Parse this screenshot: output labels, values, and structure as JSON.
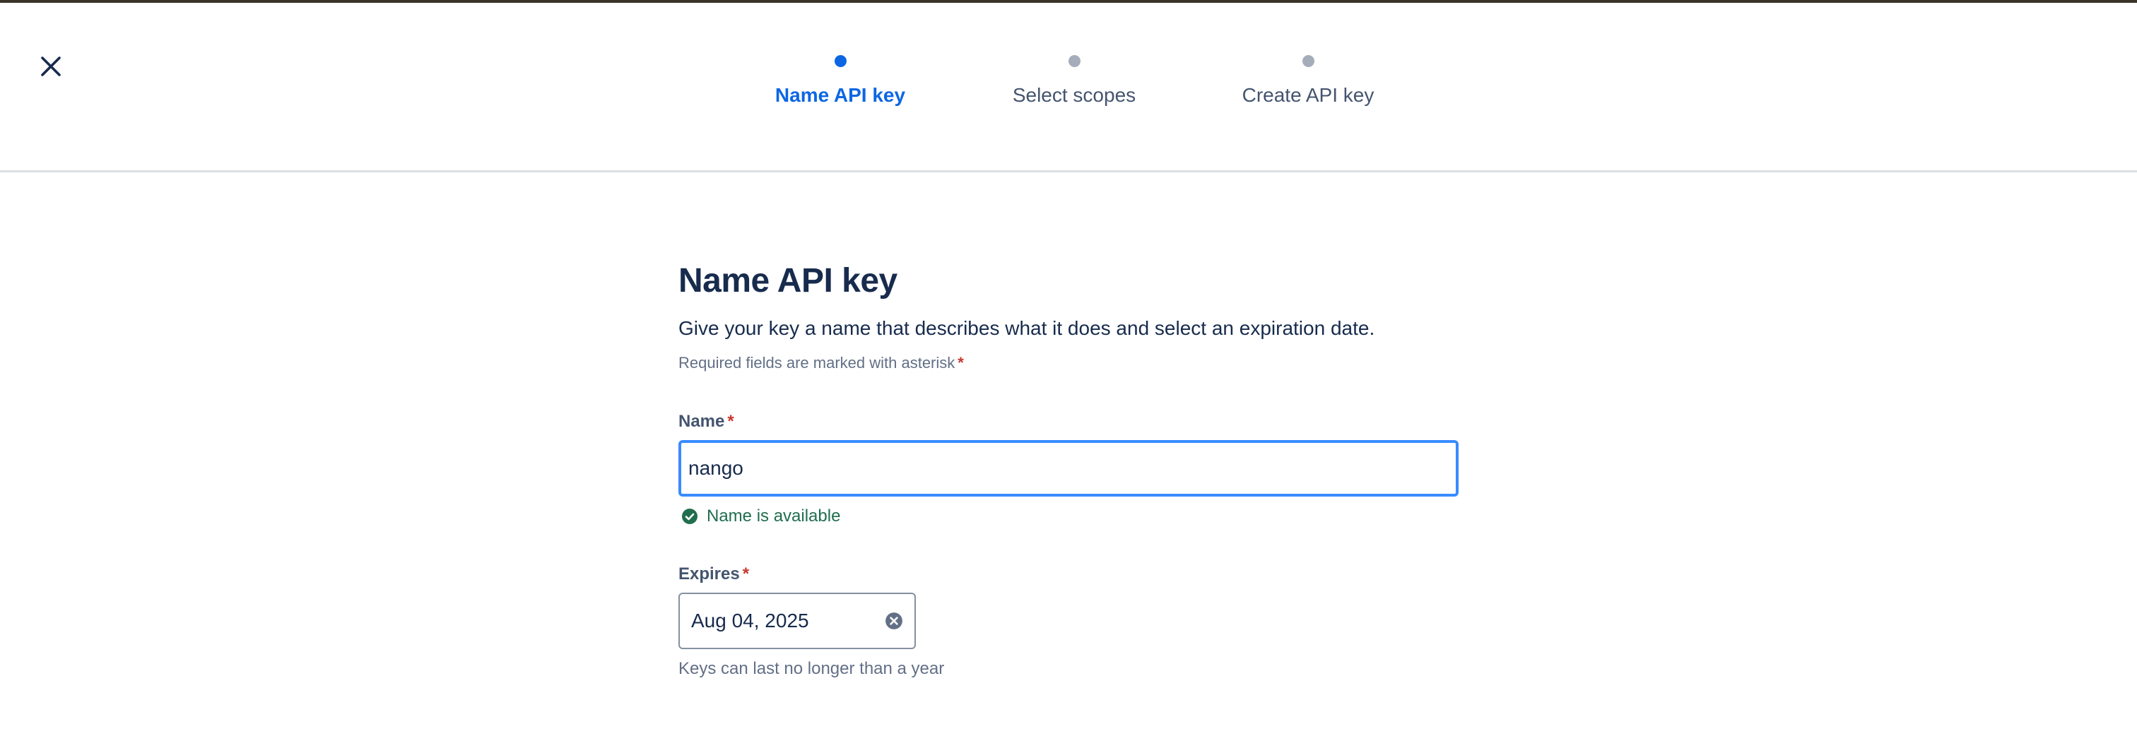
{
  "header": {
    "close_icon": "close-icon",
    "steps": [
      {
        "label": "Name API key",
        "active": true
      },
      {
        "label": "Select scopes",
        "active": false
      },
      {
        "label": "Create API key",
        "active": false
      }
    ]
  },
  "form": {
    "title": "Name API key",
    "description": "Give your key a name that describes what it does and select an expiration date.",
    "required_note": "Required fields are marked with asterisk",
    "asterisk": "*",
    "name": {
      "label": "Name",
      "value": "nango",
      "validation": "Name is available",
      "validation_icon": "check-circle-icon"
    },
    "expires": {
      "label": "Expires",
      "value": "Aug 04, 2025",
      "clear_icon": "clear-circle-icon",
      "helper": "Keys can last no longer than a year"
    }
  },
  "colors": {
    "accent": "#0c66e4",
    "focus_border": "#388bff",
    "success": "#216e4e",
    "required": "#c9372c",
    "text": "#172b4d",
    "subtle": "#626f86"
  }
}
